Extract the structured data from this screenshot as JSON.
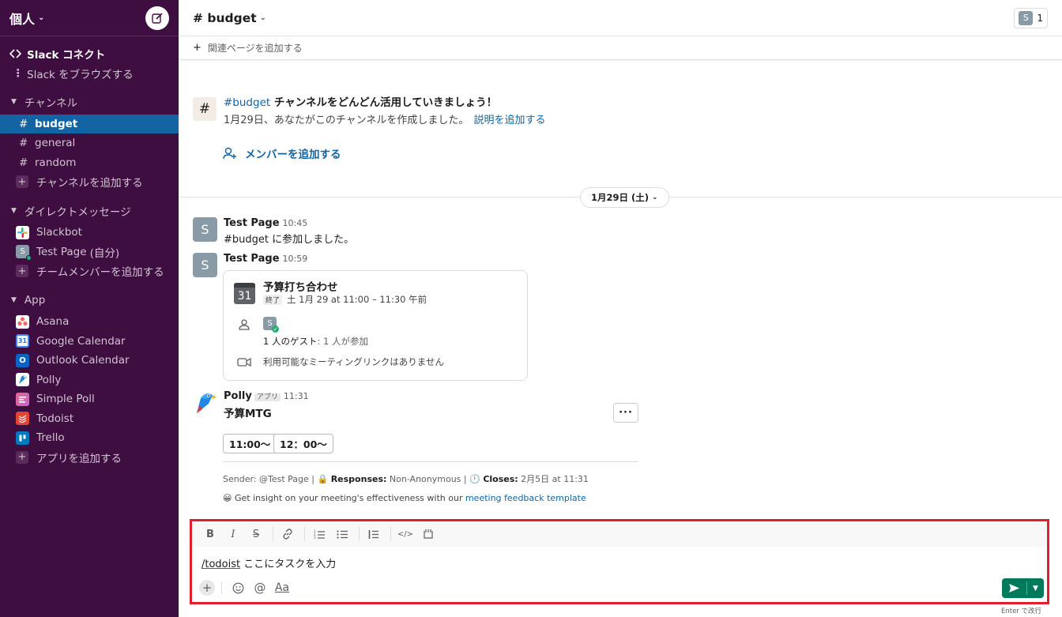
{
  "sidebar": {
    "workspace": "個人",
    "connect": "Slack コネクト",
    "browse": "Slack をブラウズする",
    "channels_head": "チャンネル",
    "channels": [
      "budget",
      "general",
      "random"
    ],
    "add_channel": "チャンネルを追加する",
    "dm_head": "ダイレクトメッセージ",
    "dms": [
      {
        "name": "Slackbot"
      },
      {
        "name": "Test Page",
        "suffix": "(自分)"
      }
    ],
    "add_member": "チームメンバーを追加する",
    "app_head": "App",
    "apps": [
      "Asana",
      "Google Calendar",
      "Outlook Calendar",
      "Polly",
      "Simple Poll",
      "Todoist",
      "Trello"
    ],
    "add_app": "アプリを追加する"
  },
  "header": {
    "channel": "# budget",
    "member_initial": "S",
    "member_count": "1",
    "add_bookmark": "関連ページを追加する"
  },
  "intro": {
    "hash": "#",
    "channel_link": "#budget",
    "title_rest": " チャンネルをどんどん活用していきましょう！",
    "sub": "1月29日、あなたがこのチャンネルを作成しました。",
    "desc_link": "説明を追加する",
    "add_member": "メンバーを追加する"
  },
  "date_divider": "1月29日 (土)",
  "messages": [
    {
      "initial": "S",
      "sender": "Test Page",
      "time": "10:45",
      "text": "#budget に参加しました。"
    },
    {
      "initial": "S",
      "sender": "Test Page",
      "time": "10:59"
    }
  ],
  "calendar_card": {
    "day": "31",
    "title": "予算打ち合わせ",
    "ended": "終了",
    "when": "土 1月 29 at 11:00 – 11:30 午前",
    "guest_initial": "S",
    "guests": "1 人のゲスト",
    "guests_detail": ": 1 人が参加",
    "no_link": "利用可能なミーティングリンクはありません"
  },
  "polly": {
    "sender": "Polly",
    "app_tag": "アプリ",
    "time": "11:31",
    "title": "予算MTG",
    "more": "···",
    "options": [
      "11:00〜",
      "12：00〜"
    ],
    "meta_sender": "Sender: @Test Page | ",
    "meta_resp_label": "Responses:",
    "meta_resp_value": " Non-Anonymous | ",
    "meta_close_label": "Closes:",
    "meta_close_value": " 2月5日 at 11:31",
    "insight_text": "Get insight on your meeting's effectiveness with our ",
    "insight_link": "meeting feedback template"
  },
  "composer": {
    "command": "/todoist",
    "text": " ここにタスクを入力",
    "enter_hint": "Enter で改行"
  },
  "colors": {
    "sidebar_bg": "#3f0e40",
    "active": "#1264a3",
    "send": "#007a5a",
    "highlight_border": "#e01e2e"
  }
}
